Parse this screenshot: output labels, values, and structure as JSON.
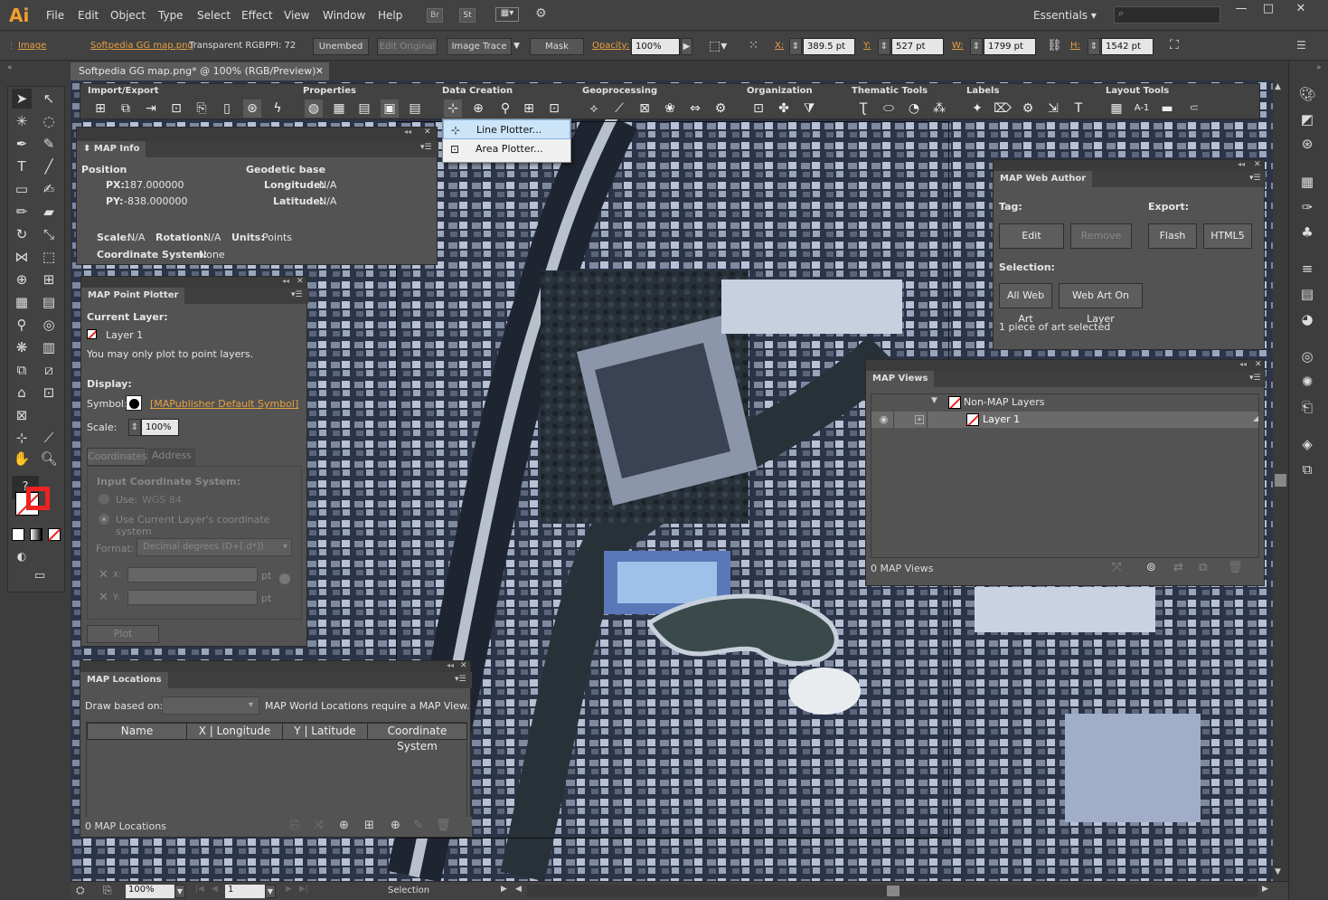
{
  "app": {
    "logo": "Ai"
  },
  "menu": [
    "File",
    "Edit",
    "Object",
    "Type",
    "Select",
    "Effect",
    "View",
    "Window",
    "Help"
  ],
  "mini_buttons": [
    "Br",
    "St"
  ],
  "workspace": "Essentials",
  "control": {
    "image": "Image",
    "file": "Softpedia GG map.png",
    "color": "Transparent RGB",
    "ppi": "PPI: 72",
    "unembed": "Unembed",
    "edit_original": "Edit Original",
    "image_trace": "Image Trace",
    "mask": "Mask",
    "opacity_label": "Opacity:",
    "opacity": "100%",
    "x_label": "X:",
    "x": "389.5 pt",
    "y_label": "Y:",
    "y": "527 pt",
    "w_label": "W:",
    "w": "1799 pt",
    "h_label": "H:",
    "h": "1542 pt"
  },
  "doc_tab": "Softpedia GG map.png* @ 100% (RGB/Preview)",
  "map_toolbar": {
    "groups": [
      "Import/Export",
      "Properties",
      "Data Creation",
      "Geoprocessing",
      "Organization",
      "Thematic Tools",
      "Labels",
      "Layout Tools"
    ]
  },
  "dropdown": {
    "items": [
      "Line Plotter...",
      "Area Plotter..."
    ]
  },
  "map_info": {
    "title": "MAP Info",
    "position": "Position",
    "px_label": "PX:",
    "px": "187.000000",
    "py_label": "PY:",
    "py": "-838.000000",
    "geodetic": "Geodetic base",
    "lon_label": "Longitude:",
    "lon": "N/A",
    "lat_label": "Latitude:",
    "lat": "N/A",
    "scale_label": "Scale:",
    "scale": "N/A",
    "rot_label": "Rotation:",
    "rot": "N/A",
    "units_label": "Units:",
    "units": "Points",
    "cs_label": "Coordinate System:",
    "cs": "None"
  },
  "point_plotter": {
    "title": "MAP Point Plotter",
    "current_layer": "Current Layer:",
    "layer": "Layer 1",
    "note": "You may only plot to point layers.",
    "display": "Display:",
    "symbol_label": "Symbol:",
    "symbol": "[MAPublisher Default Symbol]",
    "scale_label": "Scale:",
    "scale": "100%",
    "tabs": [
      "Coordinates",
      "Address"
    ],
    "input_cs": "Input Coordinate System:",
    "use_label": "Use:",
    "use_value": "WGS 84",
    "use_current": "Use Current Layer's coordinate system",
    "format_label": "Format:",
    "format": "Decimal degrees (D+[.d*])",
    "x_label": "X:",
    "y_label": "Y:",
    "unit": "pt",
    "plot": "Plot"
  },
  "locations": {
    "title": "MAP Locations",
    "draw_label": "Draw based on:",
    "note": "MAP World Locations require a MAP View.",
    "columns": [
      "Name",
      "X | Longitude",
      "Y | Latitude",
      "Coordinate System"
    ],
    "count": "0 MAP Locations"
  },
  "web_author": {
    "title": "MAP Web Author",
    "tag": "Tag:",
    "export": "Export:",
    "edit": "Edit",
    "remove": "Remove",
    "flash": "Flash",
    "html5": "HTML5",
    "selection": "Selection:",
    "all_web_art": "All Web Art",
    "web_art_on_layer": "Web Art On Layer",
    "status": "1 piece of art selected"
  },
  "map_views": {
    "title": "MAP Views",
    "group": "Non-MAP Layers",
    "layer": "Layer 1",
    "count": "0 MAP Views"
  },
  "status": {
    "zoom": "100%",
    "page": "1",
    "tool": "Selection"
  },
  "colors": {
    "accent": "#f0a030",
    "panel": "#535353",
    "chrome": "#424242"
  }
}
